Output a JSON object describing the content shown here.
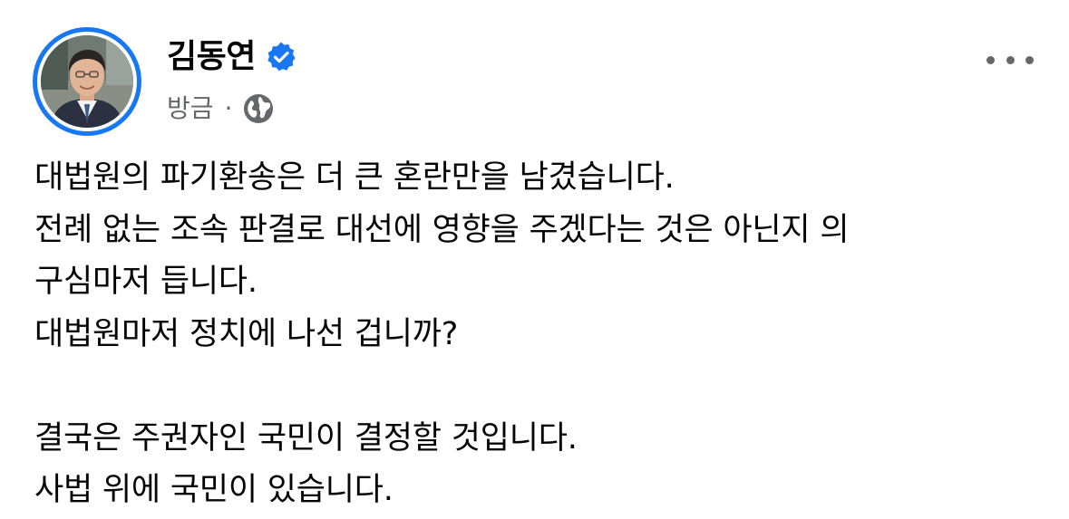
{
  "post": {
    "author_name": "김동연",
    "verified_icon": "verified-badge-icon",
    "timestamp": "방금",
    "separator": "·",
    "audience_icon": "globe-icon",
    "more_icon": "more-options-icon",
    "colors": {
      "accent": "#1877f2",
      "text": "#050505",
      "secondary": "#65676b"
    },
    "lines": [
      "대법원의 파기환송은 더 큰 혼란만을 남겼습니다.",
      "전례 없는 조속 판결로 대선에 영향을 주겠다는 것은 아닌지 의",
      "구심마저 듭니다.",
      "대법원마저 정치에 나선 겁니까?",
      "",
      "결국은 주권자인 국민이 결정할 것입니다.",
      "사법 위에 국민이 있습니다."
    ]
  }
}
